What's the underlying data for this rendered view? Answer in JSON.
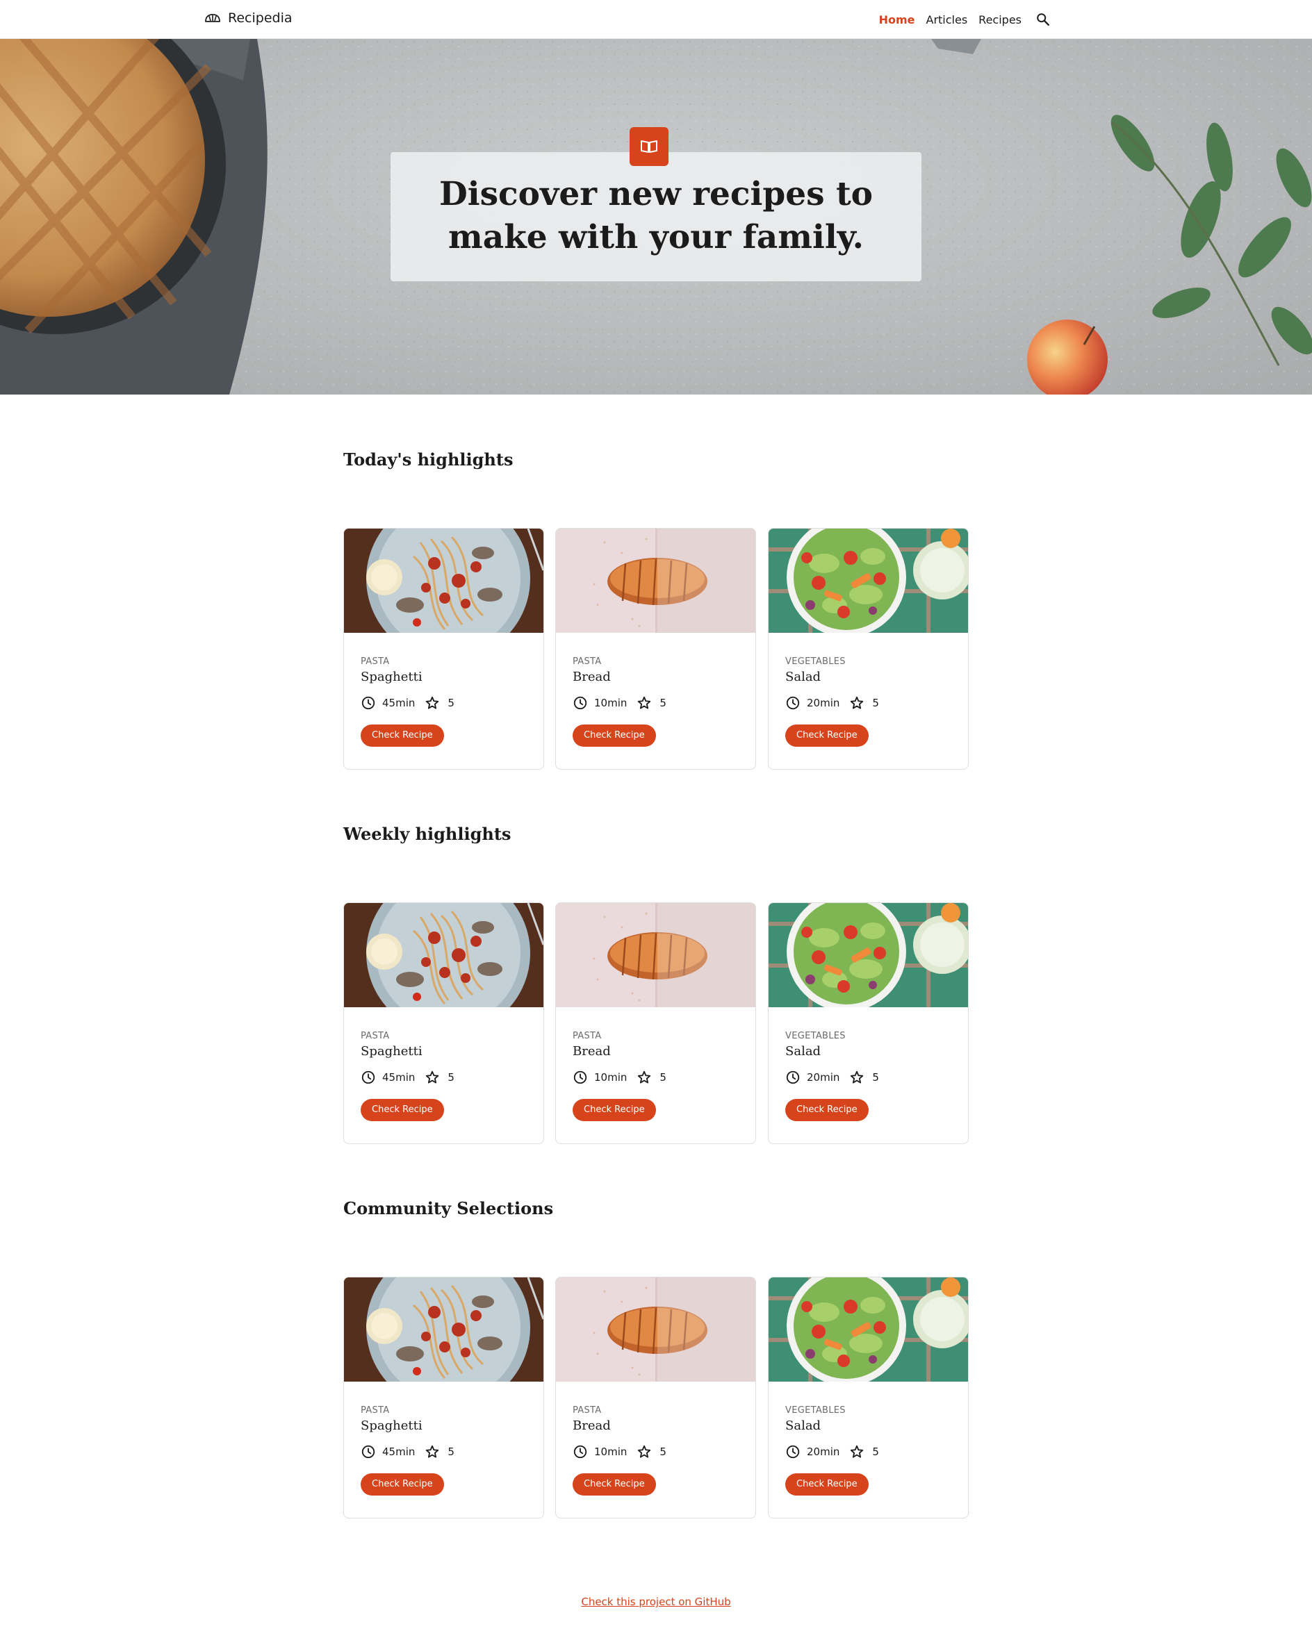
{
  "colors": {
    "accent": "#d7441b",
    "text": "#1b1b1b",
    "muted": "#6b6b6b",
    "border": "#dedede"
  },
  "nav": {
    "brand": "Recipedia",
    "links": [
      {
        "label": "Home",
        "active": true
      },
      {
        "label": "Articles",
        "active": false
      },
      {
        "label": "Recipes",
        "active": false
      }
    ],
    "search_icon": "search-icon"
  },
  "hero": {
    "badge_icon": "open-book-icon",
    "title": "Discover new recipes to make with your family."
  },
  "sections": [
    {
      "title": "Today's highlights",
      "cards": [
        {
          "category": "PASTA",
          "title": "Spaghetti",
          "time": "45min",
          "rating": "5",
          "button": "Check Recipe",
          "image": "spaghetti"
        },
        {
          "category": "PASTA",
          "title": "Bread",
          "time": "10min",
          "rating": "5",
          "button": "Check Recipe",
          "image": "bread"
        },
        {
          "category": "VEGETABLES",
          "title": "Salad",
          "time": "20min",
          "rating": "5",
          "button": "Check Recipe",
          "image": "salad"
        }
      ]
    },
    {
      "title": "Weekly highlights",
      "cards": [
        {
          "category": "PASTA",
          "title": "Spaghetti",
          "time": "45min",
          "rating": "5",
          "button": "Check Recipe",
          "image": "spaghetti"
        },
        {
          "category": "PASTA",
          "title": "Bread",
          "time": "10min",
          "rating": "5",
          "button": "Check Recipe",
          "image": "bread"
        },
        {
          "category": "VEGETABLES",
          "title": "Salad",
          "time": "20min",
          "rating": "5",
          "button": "Check Recipe",
          "image": "salad"
        }
      ]
    },
    {
      "title": "Community Selections",
      "cards": [
        {
          "category": "PASTA",
          "title": "Spaghetti",
          "time": "45min",
          "rating": "5",
          "button": "Check Recipe",
          "image": "spaghetti"
        },
        {
          "category": "PASTA",
          "title": "Bread",
          "time": "10min",
          "rating": "5",
          "button": "Check Recipe",
          "image": "bread"
        },
        {
          "category": "VEGETABLES",
          "title": "Salad",
          "time": "20min",
          "rating": "5",
          "button": "Check Recipe",
          "image": "salad"
        }
      ]
    }
  ],
  "footer": {
    "link": "Check this project on GitHub"
  }
}
